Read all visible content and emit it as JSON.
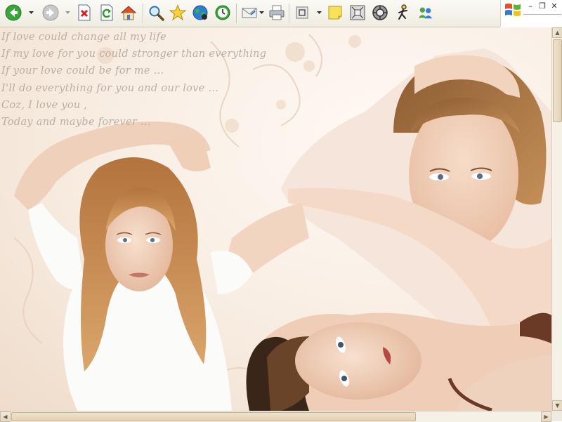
{
  "toolbar": {
    "buttons": [
      "back",
      "forward",
      "stop",
      "refresh",
      "home",
      "search",
      "favorites",
      "media",
      "history",
      "mail",
      "print",
      "fullscreen",
      "notes",
      "research",
      "messenger-settings",
      "aim",
      "msn-messenger"
    ]
  },
  "window_controls": {
    "minimize": "–",
    "restore": "❐",
    "close": "✕"
  },
  "poem": {
    "lines": [
      "If love could change all my life",
      "If my love for you could stronger than everything",
      "If your love could be for me ...",
      "I'll do everything for you and our love ...",
      "Coz, I love you ,",
      "Today and maybe forever ..."
    ]
  },
  "scrollbars": {
    "up_arrow": "▲",
    "down_arrow": "▼",
    "left_arrow": "◀",
    "right_arrow": "▶"
  },
  "colors": {
    "toolbar_bg": "#efece1",
    "page_bg": "#f7ebdf",
    "poem_text": "#b6a79c",
    "scrollbar": "#e5d8c2"
  }
}
